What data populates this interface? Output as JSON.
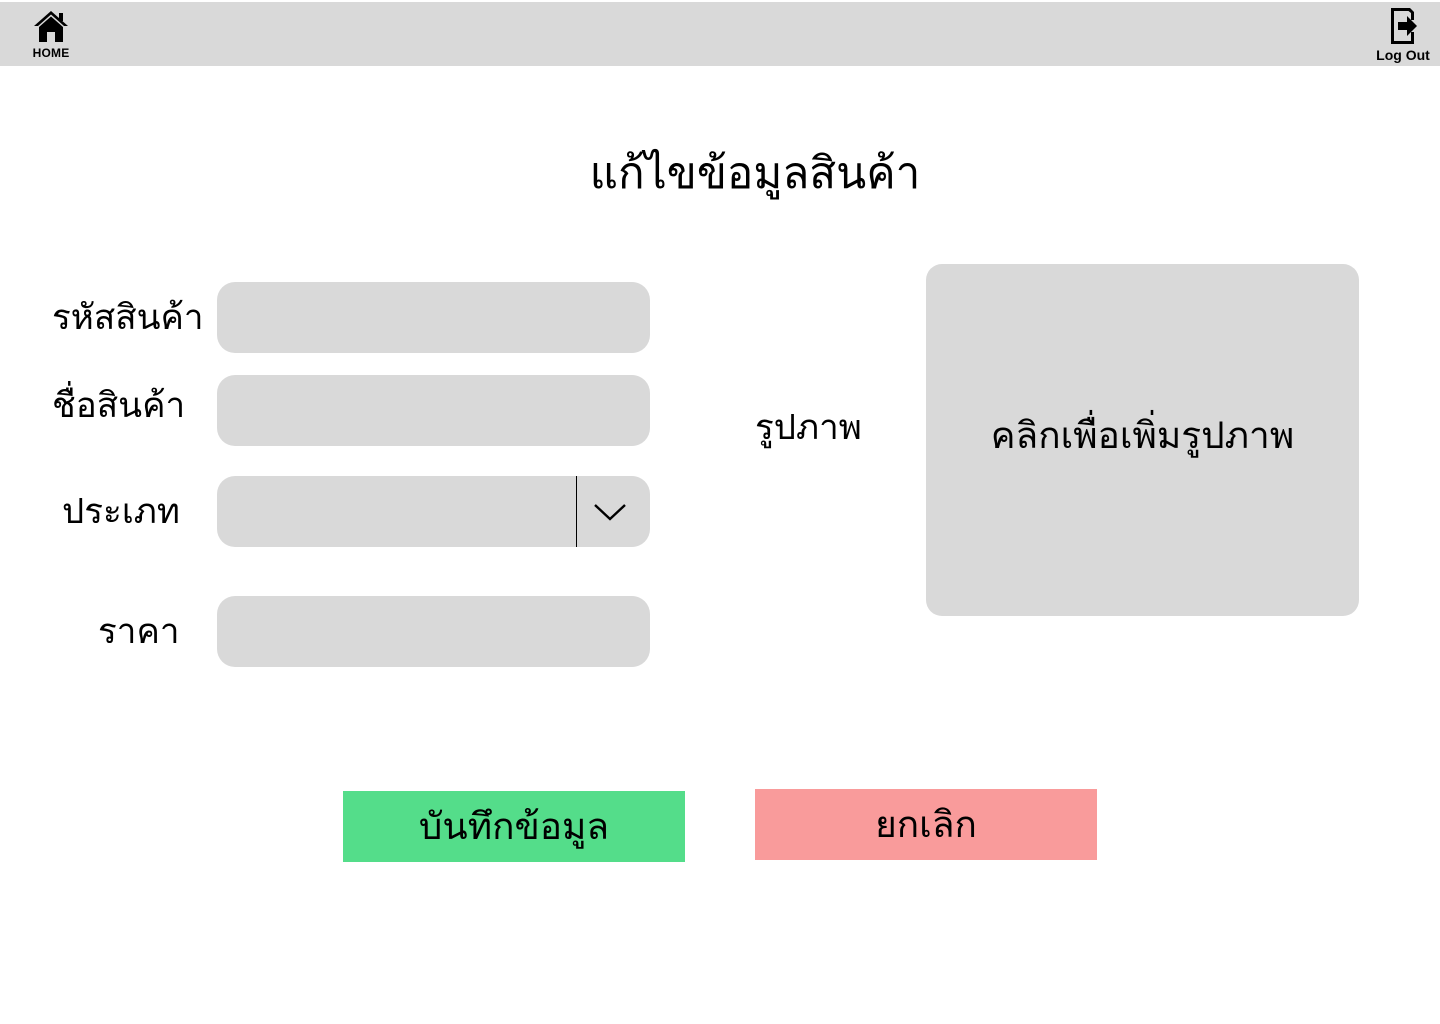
{
  "nav": {
    "home_label": "HOME",
    "logout_label": "Log Out"
  },
  "page": {
    "title": "แก้ไขข้อมูลสินค้า"
  },
  "form": {
    "product_code": {
      "label": "รหัสสินค้า",
      "value": "",
      "placeholder": ""
    },
    "product_name": {
      "label": "ชื่อสินค้า",
      "value": "",
      "placeholder": ""
    },
    "category": {
      "label": "ประเภท",
      "selected": ""
    },
    "price": {
      "label": "ราคา",
      "value": "",
      "placeholder": ""
    },
    "image": {
      "label": "รูปภาพ",
      "upload_text": "คลิกเพื่อเพิ่มรูปภาพ"
    }
  },
  "actions": {
    "save_label": "บันทึกข้อมูล",
    "cancel_label": "ยกเลิก"
  },
  "colors": {
    "topbar": "#d9d9d9",
    "field": "#d9d9d9",
    "save": "#54dd8a",
    "cancel": "#f99b9b"
  },
  "icons": {
    "home": "home-icon",
    "logout": "logout-icon",
    "dropdown": "chevron-down-icon"
  }
}
